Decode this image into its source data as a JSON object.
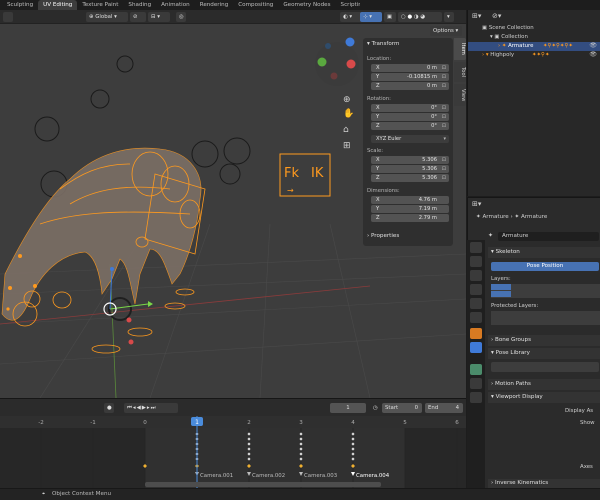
{
  "workspace_tabs": [
    "Sculpting",
    "UV Editing",
    "Texture Paint",
    "Shading",
    "Animation",
    "Rendering",
    "Compositing",
    "Geometry Nodes",
    "Scripting"
  ],
  "active_tab": "UV Editing",
  "viewport_header": {
    "orientation": "Global",
    "options": "Options"
  },
  "viewport_labels": {
    "fk": "Fk",
    "ik": "IK",
    "arrow": "→"
  },
  "npanel": {
    "tabs": [
      "Item",
      "Tool",
      "View"
    ],
    "transform_title": "Transform",
    "location_label": "Location:",
    "location": [
      {
        "k": "X",
        "v": "0 m"
      },
      {
        "k": "Y",
        "v": "-0.10815 m"
      },
      {
        "k": "Z",
        "v": "0 m"
      }
    ],
    "rotation_label": "Rotation:",
    "rotation": [
      {
        "k": "X",
        "v": "0°"
      },
      {
        "k": "Y",
        "v": "0°"
      },
      {
        "k": "Z",
        "v": "0°"
      }
    ],
    "rotation_mode": "XYZ Euler",
    "scale_label": "Scale:",
    "scale": [
      {
        "k": "X",
        "v": "5.306"
      },
      {
        "k": "Y",
        "v": "5.306"
      },
      {
        "k": "Z",
        "v": "5.306"
      }
    ],
    "dimensions_label": "Dimensions:",
    "dimensions": [
      {
        "k": "X",
        "v": "4.76 m"
      },
      {
        "k": "Y",
        "v": "7.19 m"
      },
      {
        "k": "Z",
        "v": "2.79 m"
      }
    ],
    "properties_title": "Properties"
  },
  "timeline": {
    "current_frame": "1",
    "start_label": "Start",
    "start_value": "0",
    "end_label": "End",
    "end_value": "4",
    "ruler": [
      "-2",
      "-1",
      "0",
      "1",
      "2",
      "3",
      "4",
      "5",
      "6"
    ],
    "current": "1",
    "markers": [
      "Camera.001",
      "Camera.002",
      "Camera.003",
      "Camera.004"
    ]
  },
  "statusbar": {
    "text": "Object Context Menu"
  },
  "outliner": {
    "rows": [
      "Scene Collection",
      "Collection",
      "Armature",
      "Highpoly"
    ]
  },
  "properties": {
    "breadcrumb_obj": "Armature",
    "breadcrumb_data": "Armature",
    "data_name": "Armature",
    "skeleton": "Skeleton",
    "pose_position": "Pose Position",
    "layers": "Layers:",
    "protected_layers": "Protected Layers:",
    "sections": [
      "Bone Groups",
      "Pose Library",
      "Motion Paths",
      "Viewport Display",
      "Inverse Kinematics"
    ],
    "display_as": "Display As",
    "show": "Show",
    "axes": "Axes"
  },
  "colors": {
    "accent": "#4772b3",
    "selection": "#334d80",
    "rig_orange": "#ff9a1e",
    "playhead": "#4a8cdc"
  }
}
